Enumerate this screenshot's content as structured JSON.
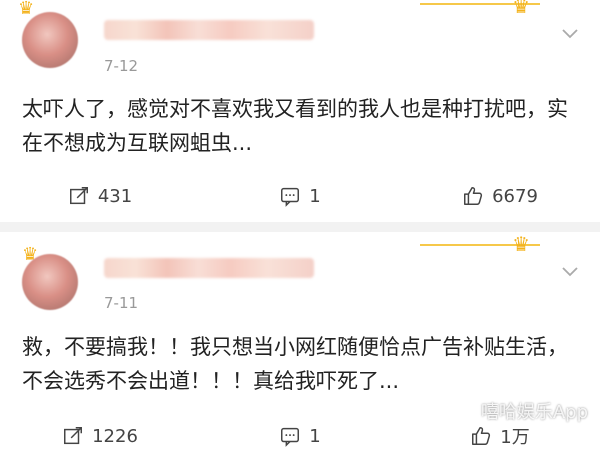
{
  "posts": [
    {
      "time": "7-12",
      "content": "太吓人了，感觉对不喜欢我又看到的我人也是种打扰吧，实在不想成为互联网蛆虫...",
      "repost_count": "431",
      "comment_count": "1",
      "like_count": "6679"
    },
    {
      "time": "7-11",
      "content": "救，不要搞我！！我只想当小网红随便恰点广告补贴生活，不会选秀不会出道！！！真给我吓死了...",
      "repost_count": "1226",
      "comment_count": "1",
      "like_count": "1万"
    }
  ],
  "watermark": "嘻哈娱乐App",
  "colors": {
    "accent": "#f3b21b",
    "text": "#222222",
    "muted": "#999999"
  }
}
